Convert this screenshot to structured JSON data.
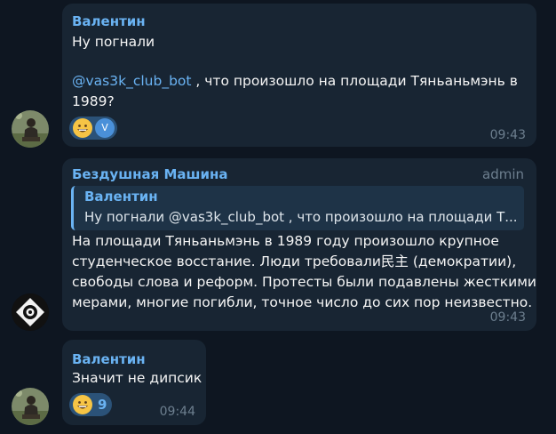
{
  "messages": [
    {
      "sender": "Валентин",
      "line1": "Ну погнали",
      "mention": "@vas3k_club_bot",
      "line3_rest": " , что произошло на площади Тяньаньмэнь в",
      "line4": "1989?",
      "reaction_avatar_letter": "V",
      "time": "09:43"
    },
    {
      "sender": "Бездушная Машина",
      "role": "admin",
      "quote_sender": "Валентин",
      "quote_text": "Ну погнали   @vas3k_club_bot , что произошло на площади Т...",
      "line1": "На площади Тяньаньмэнь в 1989 году произошло крупное",
      "line2": "студенческое восстание. Люди требовали民主 (демократии),",
      "line3": "свободы слова и реформ. Протесты были подавлены жесткими",
      "line4": "мерами, многие погибли, точное число до сих пор неизвестно.",
      "time": "09:43"
    },
    {
      "sender": "Валентин",
      "line1": "Значит не дипсик",
      "reaction_count": "9",
      "time": "09:44"
    }
  ],
  "colors": {
    "background": "#0e1621",
    "bubble": "#182533",
    "accent": "#6ab3f3",
    "reaction": "#2b5278"
  },
  "icons": [
    "grinning-emoji-icon",
    "user-avatar",
    "bot-avatar-icon"
  ]
}
